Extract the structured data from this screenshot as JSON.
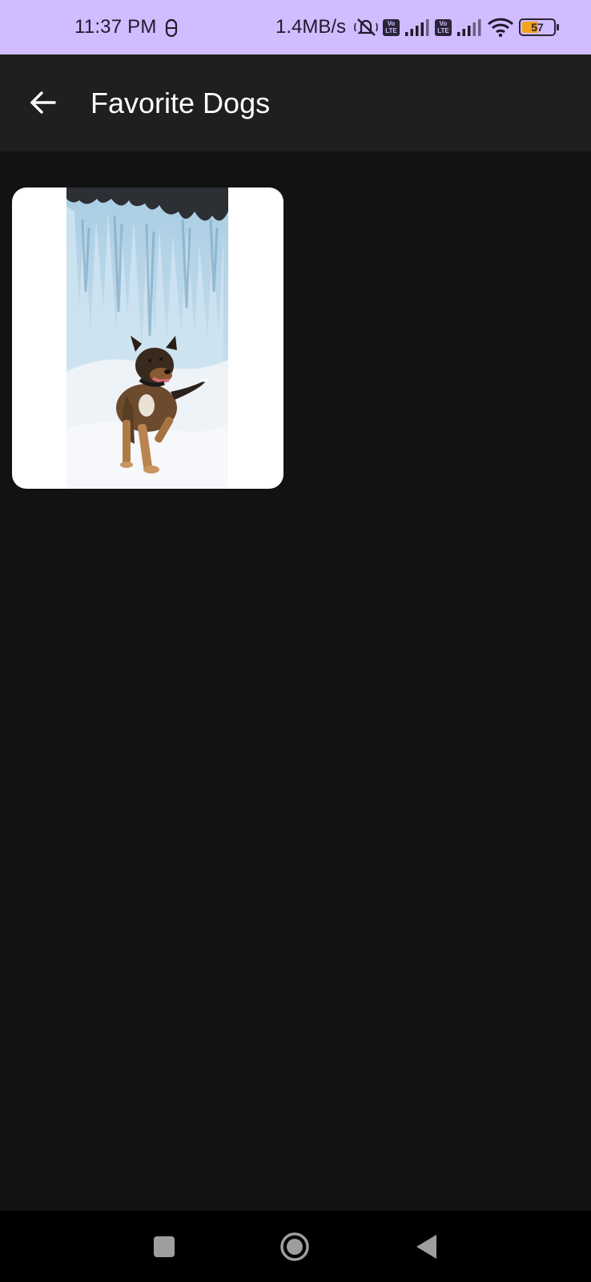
{
  "status_bar": {
    "time": "11:37 PM",
    "net_speed": "1.4MB/s",
    "volte_top": "Vo",
    "volte_bottom": "LTE",
    "battery_level": "57",
    "battery_fraction": 0.57,
    "icons": [
      "notification-icon",
      "mute-icon",
      "volte-icon",
      "signal-icon",
      "volte-icon",
      "signal-icon",
      "wifi-icon",
      "battery-icon"
    ]
  },
  "app_bar": {
    "title": "Favorite Dogs",
    "back_icon": "arrow-back-icon"
  },
  "favorites": [
    {
      "subject": "dog running in snow in front of frozen waterfall"
    }
  ],
  "nav_bar": {
    "icons": [
      "recents-icon",
      "home-icon",
      "back-icon"
    ]
  },
  "colors": {
    "status_bar_bg": "#d0bcff",
    "app_bar_bg": "#1f1f1f",
    "background": "#121212",
    "card_bg": "#ffffff",
    "nav_bar_bg": "#000000",
    "battery_fill": "#f3a21b"
  }
}
